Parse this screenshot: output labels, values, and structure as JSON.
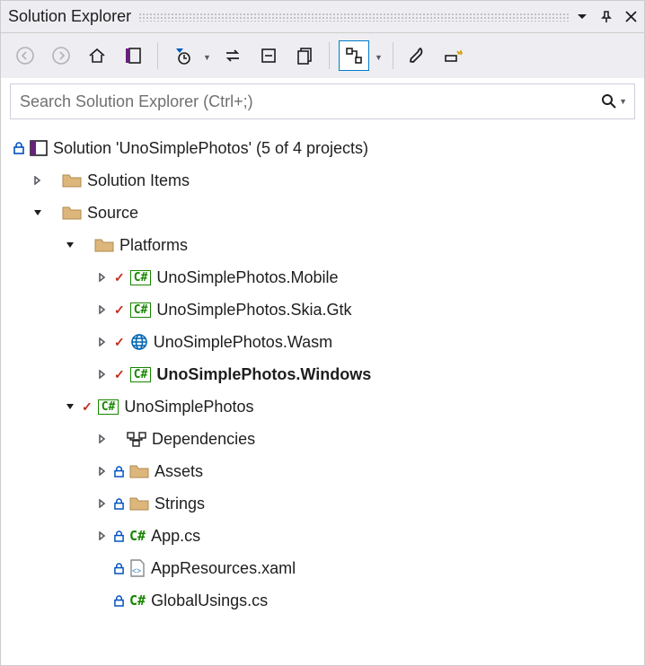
{
  "title": "Solution Explorer",
  "search": {
    "placeholder": "Search Solution Explorer (Ctrl+;)"
  },
  "tree": {
    "solution": "Solution 'UnoSimplePhotos' (5 of 4 projects)",
    "solutionItems": "Solution Items",
    "source": "Source",
    "platforms": "Platforms",
    "proj_mobile": "UnoSimplePhotos.Mobile",
    "proj_skia": "UnoSimplePhotos.Skia.Gtk",
    "proj_wasm": "UnoSimplePhotos.Wasm",
    "proj_windows": "UnoSimplePhotos.Windows",
    "proj_main": "UnoSimplePhotos",
    "dependencies": "Dependencies",
    "assets": "Assets",
    "strings": "Strings",
    "app_cs": "App.cs",
    "appresources": "AppResources.xaml",
    "globalusings": "GlobalUsings.cs"
  }
}
